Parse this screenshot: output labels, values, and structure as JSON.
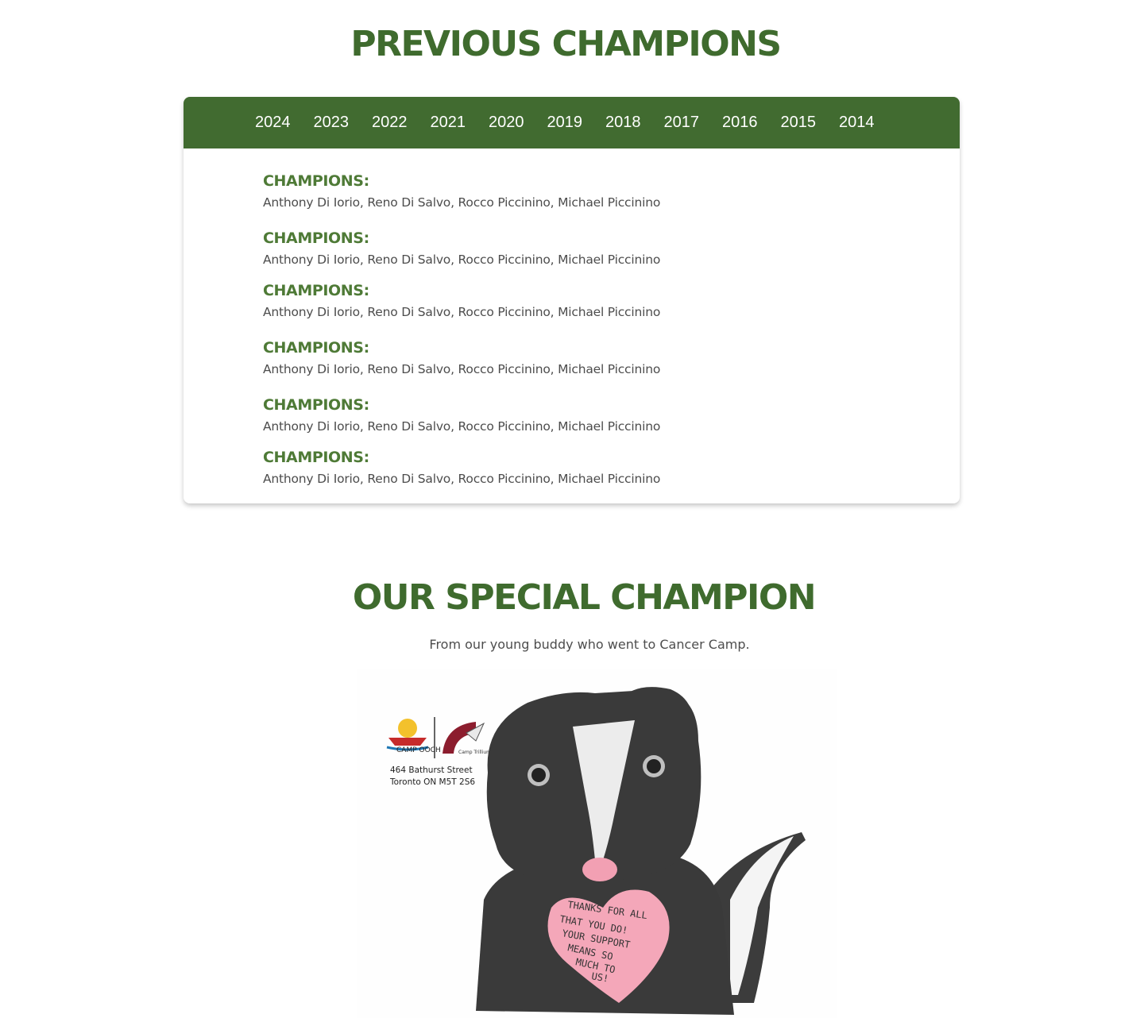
{
  "previous_champions": {
    "title": "PREVIOUS CHAMPIONS",
    "tabs": [
      "2024",
      "2023",
      "2022",
      "2021",
      "2020",
      "2019",
      "2018",
      "2017",
      "2016",
      "2015",
      "2014"
    ],
    "entries": [
      {
        "title": "CHAMPIONS:",
        "names": "Anthony Di Iorio, Reno Di Salvo, Rocco Piccinino, Michael Piccinino"
      },
      {
        "title": "CHAMPIONS:",
        "names": "Anthony Di Iorio, Reno Di Salvo, Rocco Piccinino, Michael Piccinino"
      },
      {
        "title": "CHAMPIONS:",
        "names": "Anthony Di Iorio, Reno Di Salvo, Rocco Piccinino, Michael Piccinino"
      },
      {
        "title": "CHAMPIONS:",
        "names": "Anthony Di Iorio, Reno Di Salvo, Rocco Piccinino, Michael Piccinino"
      },
      {
        "title": "CHAMPIONS:",
        "names": "Anthony Di Iorio, Reno Di Salvo, Rocco Piccinino, Michael Piccinino"
      },
      {
        "title": "CHAMPIONS:",
        "names": "Anthony Di Iorio, Reno Di Salvo, Rocco Piccinino, Michael Piccinino"
      }
    ]
  },
  "special_champion": {
    "title": "OUR SPECIAL CHAMPION",
    "subtitle": "From our young buddy who went to Cancer Camp.",
    "card": {
      "logo_left": "CAMP OOCH",
      "logo_right": "Camp Trillium",
      "address_line1": "464 Bathurst Street",
      "address_line2": "Toronto ON  M5T 2S6",
      "heart_message": [
        "THANKS FOR ALL",
        "THAT YOU DO!",
        "YOUR SUPPORT",
        "MEANS SO",
        "MUCH TO",
        "US!"
      ]
    }
  },
  "colors": {
    "brand_green": "#416b30",
    "title_green": "#3f6b2e",
    "heading_green": "#4e7a36"
  }
}
